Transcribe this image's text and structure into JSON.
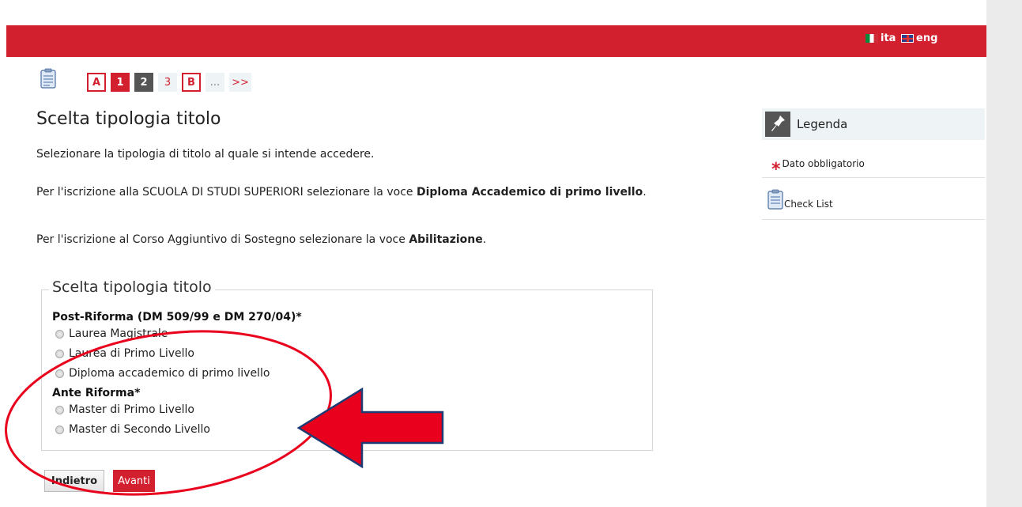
{
  "header": {
    "lang_it": "ita",
    "lang_en": "eng"
  },
  "steps": [
    "A",
    "1",
    "2",
    "3",
    "B",
    "...",
    ">>"
  ],
  "page": {
    "title": "Scelta tipologia titolo",
    "intro": "Selezionare la tipologia di titolo al quale si intende accedere.",
    "note1_pre": "Per l'iscrizione alla SCUOLA DI STUDI SUPERIORI selezionare la voce ",
    "note1_bold": "Diploma Accademico di primo livello",
    "note1_post": ".",
    "note2_pre": "Per l'iscrizione al Corso Aggiuntivo di Sostegno selezionare la voce ",
    "note2_bold": "Abilitazione",
    "note2_post": "."
  },
  "form": {
    "legend": "Scelta tipologia titolo",
    "group1_label": "Post-Riforma (DM 509/99 e DM 270/04)*",
    "group1_options": [
      "Laurea Magistrale",
      "Laurea di Primo Livello",
      "Diploma accademico di primo livello"
    ],
    "group2_label": "Ante Riforma*",
    "group2_options": [
      "Master di Primo Livello",
      "Master di Secondo Livello"
    ]
  },
  "buttons": {
    "back": "Indietro",
    "next": "Avanti"
  },
  "sidebar": {
    "legend_title": "Legenda",
    "required_label": "Dato obbligatorio",
    "checklist_label": "Check List"
  },
  "colors": {
    "brand_red": "#d2202f",
    "annotation_red": "#e8001c"
  }
}
